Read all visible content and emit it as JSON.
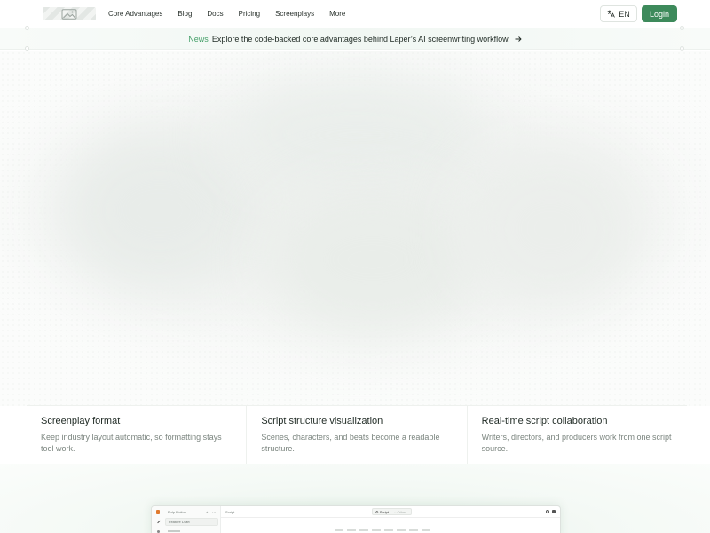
{
  "nav": {
    "logo_icon": "image-placeholder-icon",
    "links": [
      "Core Advantages",
      "Blog",
      "Docs",
      "Pricing",
      "Screenplays",
      "More"
    ],
    "language_label": "EN",
    "language_icon": "translate-icon",
    "login_label": "Login",
    "accent_color": "#3d8a5b"
  },
  "news": {
    "tag": "News",
    "text": "Explore the code-backed core advantages behind Laper’s AI screenwriting workflow.",
    "arrow_icon": "arrow-right-icon"
  },
  "features": [
    {
      "title": "Screenplay format",
      "desc": "Keep industry layout automatic, so formatting stays tool work."
    },
    {
      "title": "Script structure visualization",
      "desc": "Scenes, characters, and beats become a readable structure."
    },
    {
      "title": "Real-time script collaboration",
      "desc": "Writers, directors, and producers work from one script source."
    }
  ],
  "preview": {
    "project_name": "Pulp Fiction",
    "sidebar_item": "Feature Draft",
    "tab_title": "Script",
    "tab_script": "Script",
    "tab_other": "Other"
  }
}
